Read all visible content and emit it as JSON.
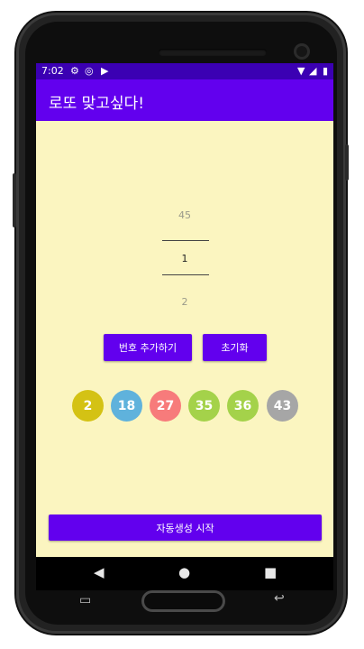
{
  "status_bar": {
    "time": "7:02",
    "left_icons": [
      "gear-icon",
      "vpn-icon",
      "play-icon"
    ],
    "right_icons": [
      "wifi-icon",
      "signal-icon",
      "battery-icon"
    ]
  },
  "app_bar": {
    "title": "로또 맞고싶다!",
    "color": "#6200ee"
  },
  "number_picker": {
    "previous": "45",
    "current": "1",
    "next": "2"
  },
  "buttons": {
    "add_number": "번호 추가하기",
    "reset": "초기화",
    "auto_generate": "자동생성 시작"
  },
  "balls": [
    {
      "number": "2",
      "color": "#d4c214"
    },
    {
      "number": "18",
      "color": "#5fb2dc"
    },
    {
      "number": "27",
      "color": "#f77b7b"
    },
    {
      "number": "35",
      "color": "#a4d24a"
    },
    {
      "number": "36",
      "color": "#a4d24a"
    },
    {
      "number": "43",
      "color": "#a6a6a6"
    }
  ],
  "nav_bar": {
    "icons": [
      "back-icon",
      "home-icon",
      "recents-icon"
    ]
  },
  "colors": {
    "background": "#fbf5c0",
    "status_bar": "#3b00b3"
  }
}
